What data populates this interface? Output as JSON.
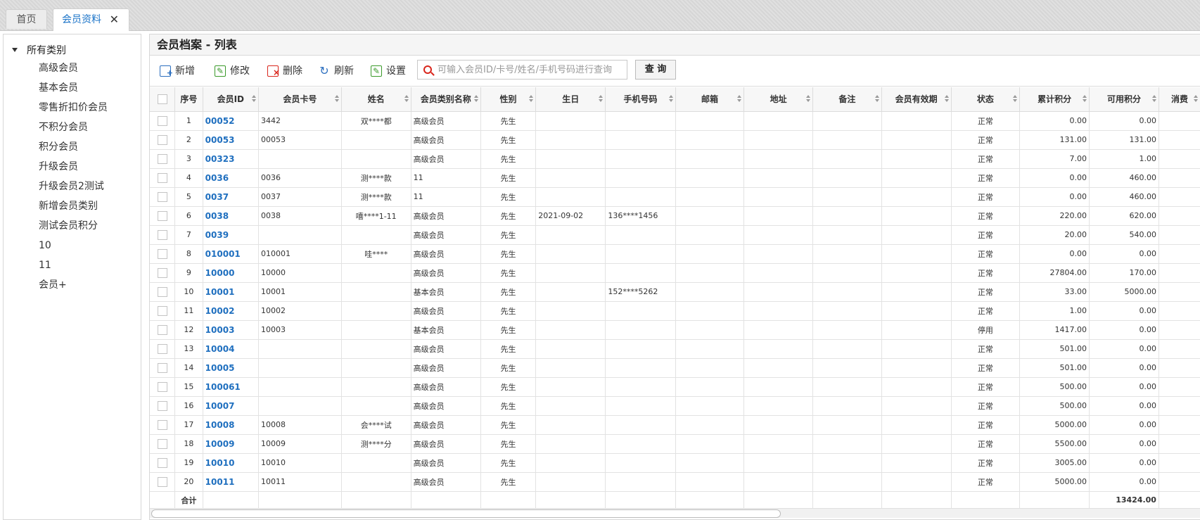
{
  "tabs": [
    {
      "label": "首页"
    },
    {
      "label": "会员资料",
      "close": "✕"
    }
  ],
  "sidebar": {
    "root": "所有类别",
    "items": [
      "高级会员",
      "基本会员",
      "零售折扣价会员",
      "不积分会员",
      "积分会员",
      "升级会员",
      "升级会员2测试",
      "新增会员类别",
      "测试会员积分",
      "10",
      "11",
      "会员+"
    ]
  },
  "panel": {
    "title": "会员档案 - 列表"
  },
  "toolbar": {
    "new_label": "新增",
    "edit_label": "修改",
    "delete_label": "删除",
    "refresh_label": "刷新",
    "settings_label": "设置",
    "search_placeholder": "可输入会员ID/卡号/姓名/手机号码进行查询",
    "query_label": "查 询"
  },
  "table": {
    "columns": [
      "序号",
      "会员ID",
      "会员卡号",
      "姓名",
      "会员类别名称",
      "性别",
      "生日",
      "手机号码",
      "邮箱",
      "地址",
      "备注",
      "会员有效期",
      "状态",
      "累计积分",
      "可用积分",
      "消费"
    ],
    "rows": [
      {
        "no": "1",
        "id": "00052",
        "card": "3442",
        "name": "双****都",
        "type": "高级会员",
        "sex": "先生",
        "birthday": "",
        "phone": "",
        "status": "正常",
        "total": "0.00",
        "avail": "0.00"
      },
      {
        "no": "2",
        "id": "00053",
        "card": "00053",
        "name": "",
        "type": "高级会员",
        "sex": "先生",
        "birthday": "",
        "phone": "",
        "status": "正常",
        "total": "131.00",
        "avail": "131.00"
      },
      {
        "no": "3",
        "id": "00323",
        "card": "",
        "name": "",
        "type": "高级会员",
        "sex": "先生",
        "birthday": "",
        "phone": "",
        "status": "正常",
        "total": "7.00",
        "avail": "1.00"
      },
      {
        "no": "4",
        "id": "0036",
        "card": "0036",
        "name": "测****款",
        "type": "11",
        "sex": "先生",
        "birthday": "",
        "phone": "",
        "status": "正常",
        "total": "0.00",
        "avail": "460.00"
      },
      {
        "no": "5",
        "id": "0037",
        "card": "0037",
        "name": "测****款",
        "type": "11",
        "sex": "先生",
        "birthday": "",
        "phone": "",
        "status": "正常",
        "total": "0.00",
        "avail": "460.00"
      },
      {
        "no": "6",
        "id": "0038",
        "card": "0038",
        "name": "嘻****1-11",
        "type": "高级会员",
        "sex": "先生",
        "birthday": "2021-09-02",
        "phone": "136****1456",
        "status": "正常",
        "total": "220.00",
        "avail": "620.00"
      },
      {
        "no": "7",
        "id": "0039",
        "card": "",
        "name": "",
        "type": "高级会员",
        "sex": "先生",
        "birthday": "",
        "phone": "",
        "status": "正常",
        "total": "20.00",
        "avail": "540.00"
      },
      {
        "no": "8",
        "id": "010001",
        "card": "010001",
        "name": "哇****",
        "type": "高级会员",
        "sex": "先生",
        "birthday": "",
        "phone": "",
        "status": "正常",
        "total": "0.00",
        "avail": "0.00"
      },
      {
        "no": "9",
        "id": "10000",
        "card": "10000",
        "name": "",
        "type": "高级会员",
        "sex": "先生",
        "birthday": "",
        "phone": "",
        "status": "正常",
        "total": "27804.00",
        "avail": "170.00"
      },
      {
        "no": "10",
        "id": "10001",
        "card": "10001",
        "name": "",
        "type": "基本会员",
        "sex": "先生",
        "birthday": "",
        "phone": "152****5262",
        "status": "正常",
        "total": "33.00",
        "avail": "5000.00"
      },
      {
        "no": "11",
        "id": "10002",
        "card": "10002",
        "name": "",
        "type": "高级会员",
        "sex": "先生",
        "birthday": "",
        "phone": "",
        "status": "正常",
        "total": "1.00",
        "avail": "0.00"
      },
      {
        "no": "12",
        "id": "10003",
        "card": "10003",
        "name": "",
        "type": "基本会员",
        "sex": "先生",
        "birthday": "",
        "phone": "",
        "status": "停用",
        "total": "1417.00",
        "avail": "0.00"
      },
      {
        "no": "13",
        "id": "10004",
        "card": "",
        "name": "",
        "type": "高级会员",
        "sex": "先生",
        "birthday": "",
        "phone": "",
        "status": "正常",
        "total": "501.00",
        "avail": "0.00"
      },
      {
        "no": "14",
        "id": "10005",
        "card": "",
        "name": "",
        "type": "高级会员",
        "sex": "先生",
        "birthday": "",
        "phone": "",
        "status": "正常",
        "total": "501.00",
        "avail": "0.00"
      },
      {
        "no": "15",
        "id": "100061",
        "card": "",
        "name": "",
        "type": "高级会员",
        "sex": "先生",
        "birthday": "",
        "phone": "",
        "status": "正常",
        "total": "500.00",
        "avail": "0.00"
      },
      {
        "no": "16",
        "id": "10007",
        "card": "",
        "name": "",
        "type": "高级会员",
        "sex": "先生",
        "birthday": "",
        "phone": "",
        "status": "正常",
        "total": "500.00",
        "avail": "0.00"
      },
      {
        "no": "17",
        "id": "10008",
        "card": "10008",
        "name": "会****试",
        "type": "高级会员",
        "sex": "先生",
        "birthday": "",
        "phone": "",
        "status": "正常",
        "total": "5000.00",
        "avail": "0.00"
      },
      {
        "no": "18",
        "id": "10009",
        "card": "10009",
        "name": "测****分",
        "type": "高级会员",
        "sex": "先生",
        "birthday": "",
        "phone": "",
        "status": "正常",
        "total": "5500.00",
        "avail": "0.00"
      },
      {
        "no": "19",
        "id": "10010",
        "card": "10010",
        "name": "",
        "type": "高级会员",
        "sex": "先生",
        "birthday": "",
        "phone": "",
        "status": "正常",
        "total": "3005.00",
        "avail": "0.00"
      },
      {
        "no": "20",
        "id": "10011",
        "card": "10011",
        "name": "",
        "type": "高级会员",
        "sex": "先生",
        "birthday": "",
        "phone": "",
        "status": "正常",
        "total": "5000.00",
        "avail": "0.00"
      }
    ],
    "total_label": "合计",
    "total_avail": "13424.00"
  }
}
